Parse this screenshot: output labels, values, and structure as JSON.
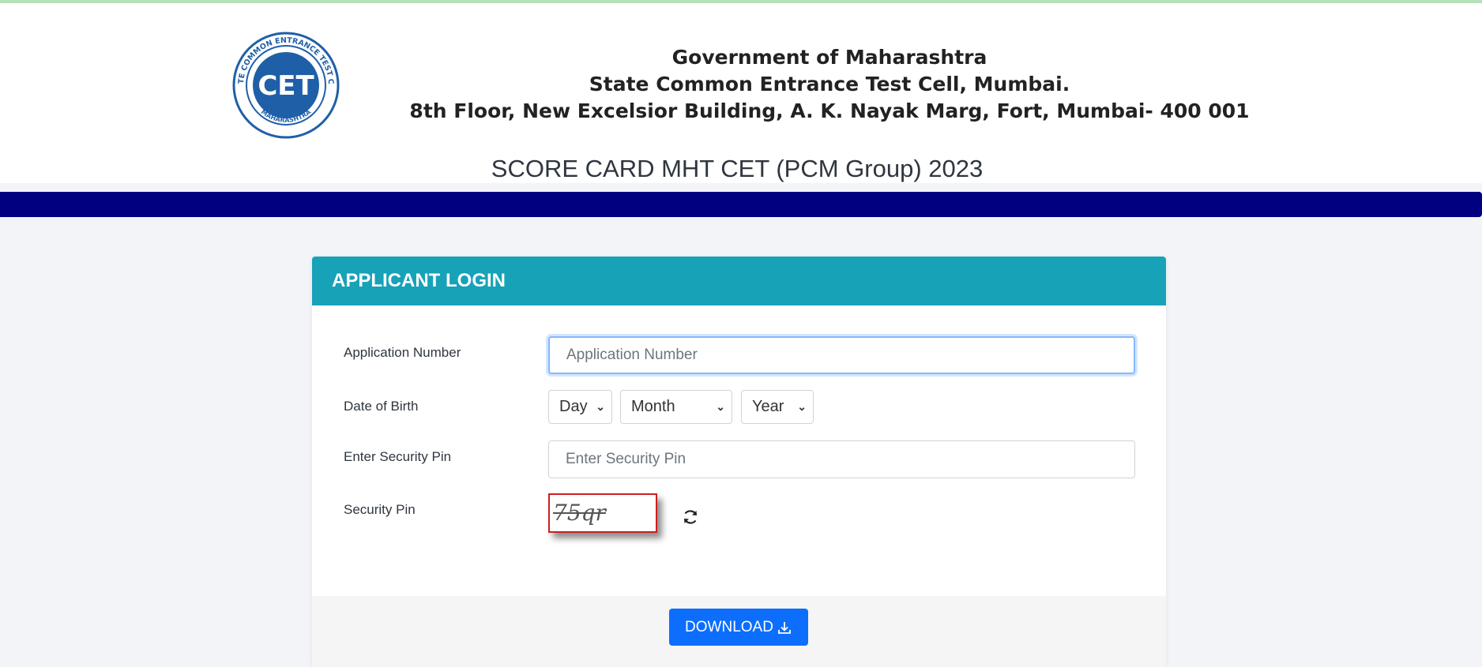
{
  "header": {
    "logo_text": "CET",
    "logo_ring_top": "STATE COMMON ENTRANCE TEST CELL",
    "logo_ring_bottom": "MAHARASHTRA",
    "org_line1": "Government of Maharashtra",
    "org_line2": "State Common Entrance Test Cell, Mumbai.",
    "org_line3": "8th Floor, New Excelsior Building, A. K. Nayak Marg, Fort, Mumbai- 400 001",
    "score_title": "SCORE CARD MHT CET (PCM Group) 2023"
  },
  "colors": {
    "nav_bar": "#000080",
    "card_header": "#17a2b8",
    "download_button": "#0d6efd",
    "captcha_border": "#cc1f1f"
  },
  "login": {
    "title": "APPLICANT LOGIN",
    "application_number_label": "Application Number",
    "application_number_placeholder": "Application Number",
    "application_number_value": "",
    "dob_label": "Date of Birth",
    "day_selected": "Day",
    "month_selected": "Month",
    "year_selected": "Year",
    "enter_pin_label": "Enter Security Pin",
    "enter_pin_placeholder": "Enter Security Pin",
    "enter_pin_value": "",
    "security_pin_label": "Security Pin",
    "captcha_text": "75qr",
    "refresh_icon": "refresh-icon",
    "download_label": "DOWNLOAD",
    "download_icon": "download-icon"
  }
}
